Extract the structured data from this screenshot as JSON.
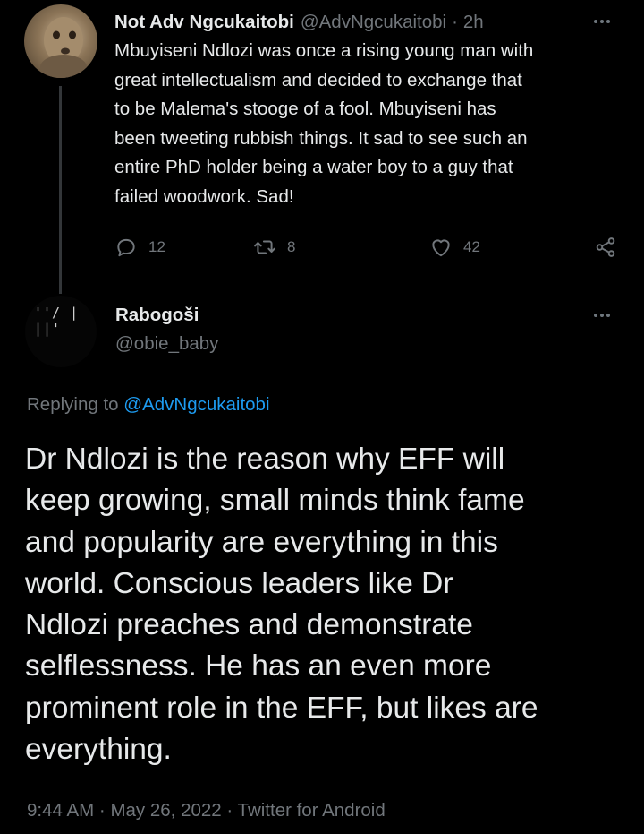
{
  "parent_tweet": {
    "display_name": "Not Adv Ngcukaitobi",
    "handle": "@AdvNgcukaitobi",
    "separator": "·",
    "time": "2h",
    "body_lines": [
      "Mbuyiseni Ndlozi was once a rising young man with",
      "great intellectualism and decided to exchange that",
      "to be Malema's stooge of a fool. Mbuyiseni has",
      "been tweeting rubbish things. It sad to see such an",
      "entire PhD holder being a water boy to a guy that",
      "failed woodwork.  Sad!"
    ],
    "actions": {
      "reply_count": "12",
      "retweet_count": "8",
      "like_count": "42"
    }
  },
  "main_tweet": {
    "display_name": "Rabogoši",
    "handle": "@obie_baby",
    "replying_prefix": "Replying to",
    "replying_to": "@AdvNgcukaitobi",
    "body_lines": [
      "Dr Ndlozi is the reason why EFF will",
      "keep growing, small minds think fame",
      "and popularity are everything in this",
      "world. Conscious leaders like Dr",
      "Ndlozi preaches and demonstrate",
      "selflessness. He has an even more",
      "prominent role in the EFF, but likes are",
      "everything."
    ],
    "meta": {
      "time": "9:44 AM",
      "sep1": "·",
      "date": "May 26, 2022",
      "sep2": "·",
      "source": "Twitter for Android"
    },
    "avatar_marks": "''/ | ||'"
  },
  "colors": {
    "background": "#000000",
    "primary_text": "#e7e9ea",
    "secondary_text": "#71767b",
    "link": "#1d9bf0"
  }
}
